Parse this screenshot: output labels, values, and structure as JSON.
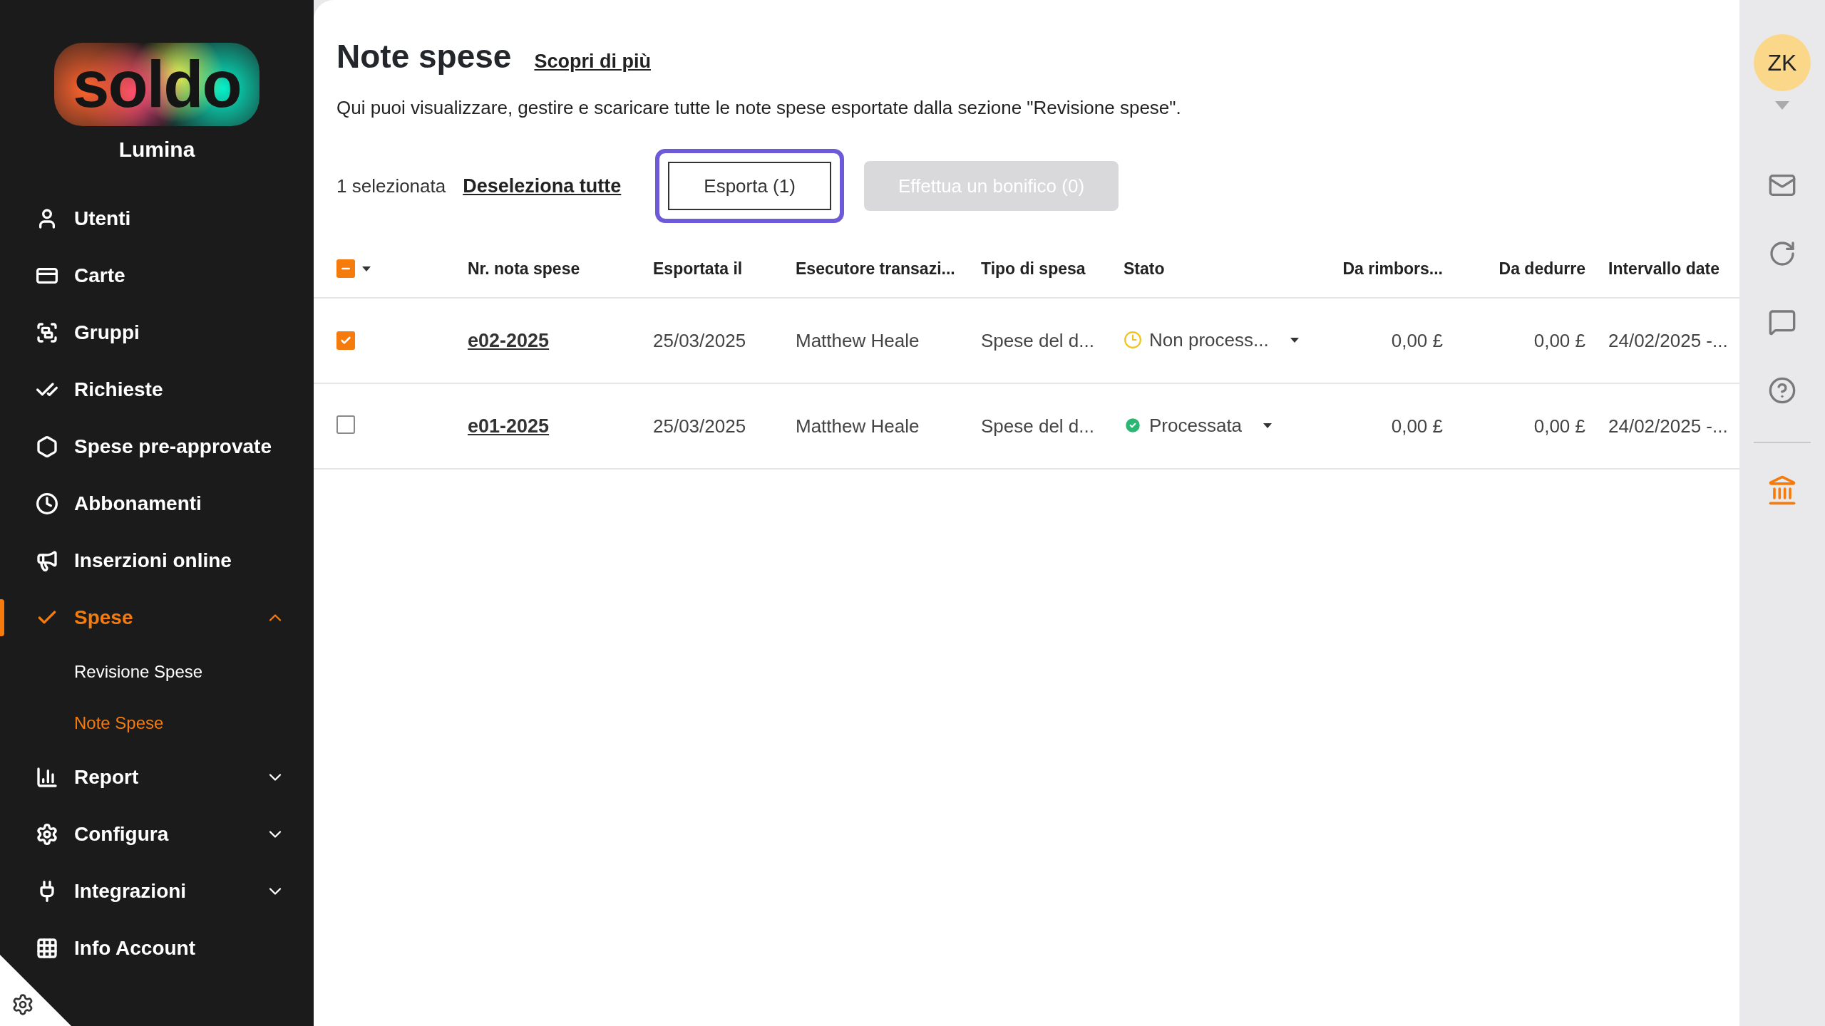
{
  "sidebar": {
    "logo": "soldo",
    "company": "Lumina",
    "items": [
      {
        "label": "Utenti",
        "kind": "link",
        "selected": false
      },
      {
        "label": "Carte",
        "kind": "link",
        "selected": false
      },
      {
        "label": "Gruppi",
        "kind": "link",
        "selected": false
      },
      {
        "label": "Richieste",
        "kind": "link",
        "selected": false
      },
      {
        "label": "Spese pre-approvate",
        "kind": "link",
        "selected": false
      },
      {
        "label": "Abbonamenti",
        "kind": "link",
        "selected": false
      },
      {
        "label": "Inserzioni online",
        "kind": "link",
        "selected": false
      },
      {
        "label": "Spese",
        "kind": "group",
        "selected": true,
        "expanded": true,
        "children": [
          {
            "label": "Revisione Spese",
            "selected": false
          },
          {
            "label": "Note Spese",
            "selected": true
          }
        ]
      },
      {
        "label": "Report",
        "kind": "group",
        "selected": false,
        "expanded": false
      },
      {
        "label": "Configura",
        "kind": "group",
        "selected": false,
        "expanded": false
      },
      {
        "label": "Integrazioni",
        "kind": "group",
        "selected": false,
        "expanded": false
      },
      {
        "label": "Info Account",
        "kind": "link",
        "selected": false
      }
    ]
  },
  "page": {
    "title": "Note spese",
    "learn_more": "Scopri di più",
    "description": "Qui puoi visualizzare, gestire e scaricare tutte le note spese esportate dalla sezione \"Revisione spese\"."
  },
  "toolbar": {
    "selection_count": "1 selezionata",
    "deselect_all": "Deseleziona tutte",
    "buttons": [
      {
        "label": "Esporta (1)",
        "focused": true,
        "disabled": false
      },
      {
        "label": "Effettua un bonifico (0)",
        "disabled": true
      }
    ]
  },
  "table": {
    "select_all": {
      "indeterminate": true
    },
    "columns": [
      "Nr. nota spese",
      "Esportata il",
      "Esecutore transazi...",
      "Tipo di spesa",
      "Stato",
      "Da rimbors...",
      "Da dedurre",
      "Intervallo date"
    ],
    "rows": [
      {
        "checked": true,
        "number": "e02-2025",
        "exported": "25/03/2025",
        "executor": "Matthew Heale",
        "type": "Spese del d...",
        "status": {
          "kind": "pending",
          "label": "Non process..."
        },
        "to_refund": "0,00 £",
        "to_deduct": "0,00 £",
        "date_range": "24/02/2025 -..."
      },
      {
        "checked": false,
        "number": "e01-2025",
        "exported": "25/03/2025",
        "executor": "Matthew Heale",
        "type": "Spese del d...",
        "status": {
          "kind": "processed",
          "label": "Processata"
        },
        "to_refund": "0,00 £",
        "to_deduct": "0,00 £",
        "date_range": "24/02/2025 -..."
      }
    ]
  },
  "rail": {
    "avatar": "ZK"
  }
}
